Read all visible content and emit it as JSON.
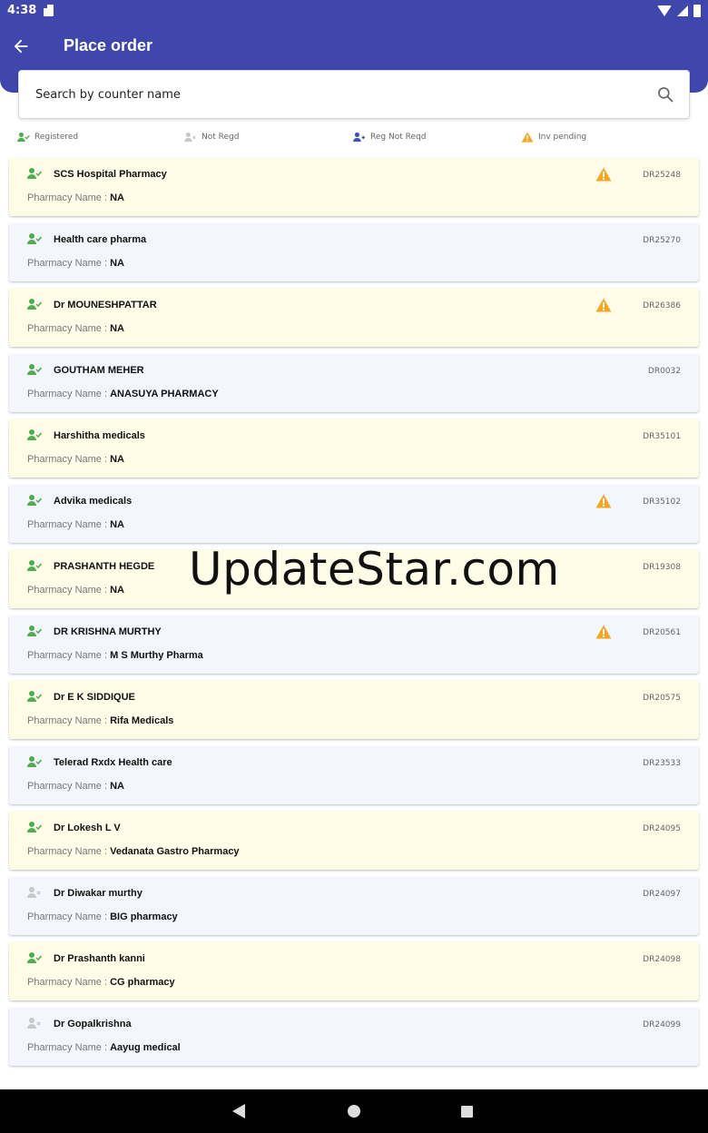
{
  "status_bar": {
    "time": "4:38"
  },
  "header": {
    "title": "Place order"
  },
  "search": {
    "placeholder": "Search by counter name"
  },
  "legend": [
    {
      "label": "Registered",
      "icon": "registered-user-icon",
      "color": "#4caf50"
    },
    {
      "label": "Not Regd",
      "icon": "not-registered-user-icon",
      "color": "#c8c8c8"
    },
    {
      "label": "Reg Not Reqd",
      "icon": "reg-not-reqd-user-icon",
      "color": "#3f51b5"
    },
    {
      "label": "Inv pending",
      "icon": "warning-icon",
      "color": "#f5a623"
    }
  ],
  "pharmacy_label": "Pharmacy Name : ",
  "counters": [
    {
      "name": "SCS Hospital Pharmacy",
      "code": "DR25248",
      "pharmacy": "NA",
      "status": "registered",
      "inv_pending": true
    },
    {
      "name": "Health care pharma",
      "code": "DR25270",
      "pharmacy": "NA",
      "status": "registered",
      "inv_pending": false
    },
    {
      "name": "Dr MOUNESHPATTAR",
      "code": "DR26386",
      "pharmacy": "NA",
      "status": "registered",
      "inv_pending": true
    },
    {
      "name": "GOUTHAM MEHER",
      "code": "DR0032",
      "pharmacy": "ANASUYA PHARMACY",
      "status": "registered",
      "inv_pending": false
    },
    {
      "name": "Harshitha medicals",
      "code": "DR35101",
      "pharmacy": "NA",
      "status": "registered",
      "inv_pending": false
    },
    {
      "name": "Advika medicals",
      "code": "DR35102",
      "pharmacy": "NA",
      "status": "registered",
      "inv_pending": true
    },
    {
      "name": "PRASHANTH HEGDE",
      "code": "DR19308",
      "pharmacy": "NA",
      "status": "registered",
      "inv_pending": false
    },
    {
      "name": "DR KRISHNA MURTHY",
      "code": "DR20561",
      "pharmacy": "M S Murthy Pharma",
      "status": "registered",
      "inv_pending": true
    },
    {
      "name": "Dr E K SIDDIQUE",
      "code": "DR20575",
      "pharmacy": "Rifa Medicals",
      "status": "registered",
      "inv_pending": false
    },
    {
      "name": "Telerad Rxdx Health care",
      "code": "DR23533",
      "pharmacy": "NA",
      "status": "registered",
      "inv_pending": false
    },
    {
      "name": "Dr Lokesh L V",
      "code": "DR24095",
      "pharmacy": "Vedanata Gastro Pharmacy",
      "status": "registered",
      "inv_pending": false
    },
    {
      "name": "Dr Diwakar murthy",
      "code": "DR24097",
      "pharmacy": "BIG pharmacy",
      "status": "not_registered",
      "inv_pending": false
    },
    {
      "name": "Dr Prashanth kanni",
      "code": "DR24098",
      "pharmacy": "CG pharmacy",
      "status": "registered",
      "inv_pending": false
    },
    {
      "name": "Dr Gopalkrishna",
      "code": "DR24099",
      "pharmacy": "Aayug medical",
      "status": "not_registered",
      "inv_pending": false
    }
  ],
  "watermark": "UpdateStar.com"
}
